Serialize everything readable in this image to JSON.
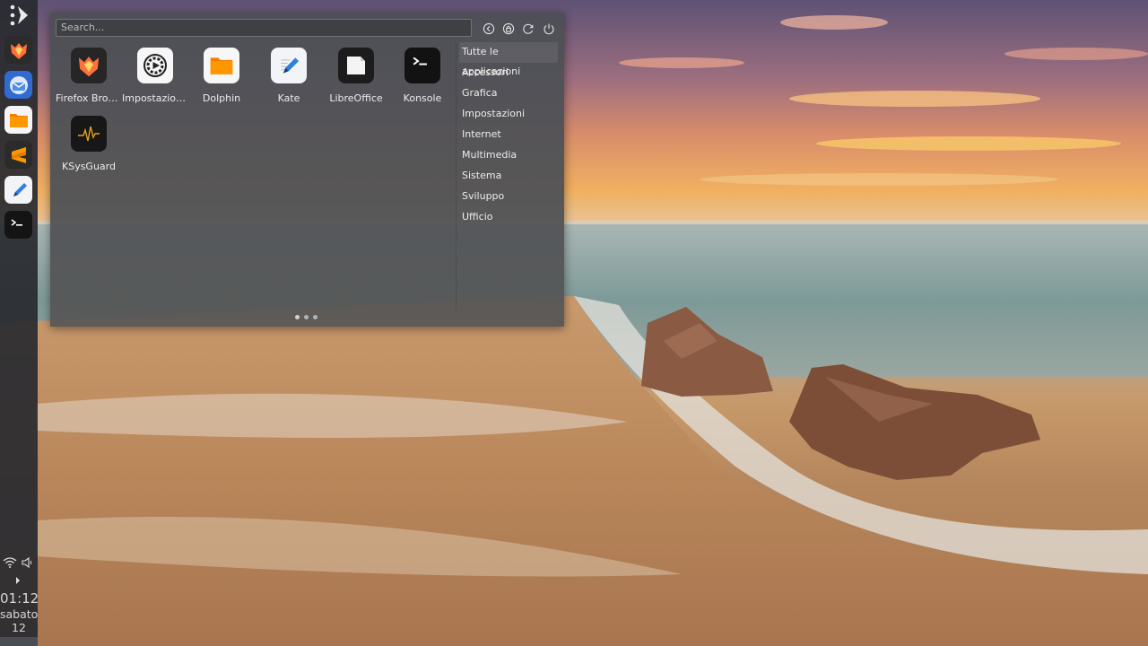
{
  "launcher": {
    "search": {
      "placeholder": "Search...",
      "value": ""
    },
    "apps": [
      {
        "label": "Firefox Brow...",
        "icon": "firefox-icon"
      },
      {
        "label": "Impostazioni...",
        "icon": "settings-icon"
      },
      {
        "label": "Dolphin",
        "icon": "folder-icon"
      },
      {
        "label": "Kate",
        "icon": "text-editor-icon"
      },
      {
        "label": "LibreOffice",
        "icon": "libreoffice-icon"
      },
      {
        "label": "Konsole",
        "icon": "terminal-icon"
      },
      {
        "label": "KSysGuard",
        "icon": "system-monitor-icon"
      }
    ],
    "categories": [
      "Tutte le applicazioni",
      "Accessori",
      "Grafica",
      "Impostazioni",
      "Internet",
      "Multimedia",
      "Sistema",
      "Sviluppo",
      "Ufficio"
    ],
    "active_category": "Tutte le applicazioni",
    "pages": 3,
    "current_page": 1
  },
  "panel": {
    "dock": [
      "firefox-icon",
      "thunderbird-icon",
      "folder-icon",
      "sublime-text-icon",
      "text-editor-icon",
      "terminal-icon"
    ],
    "clock": {
      "time": "01:12",
      "day": "sabato",
      "date": "12"
    }
  },
  "colors": {
    "panel_bg": "#282a30",
    "menu_bg": "#4e5056",
    "folder_orange": "#f57c00",
    "accent_text": "#ececec"
  }
}
